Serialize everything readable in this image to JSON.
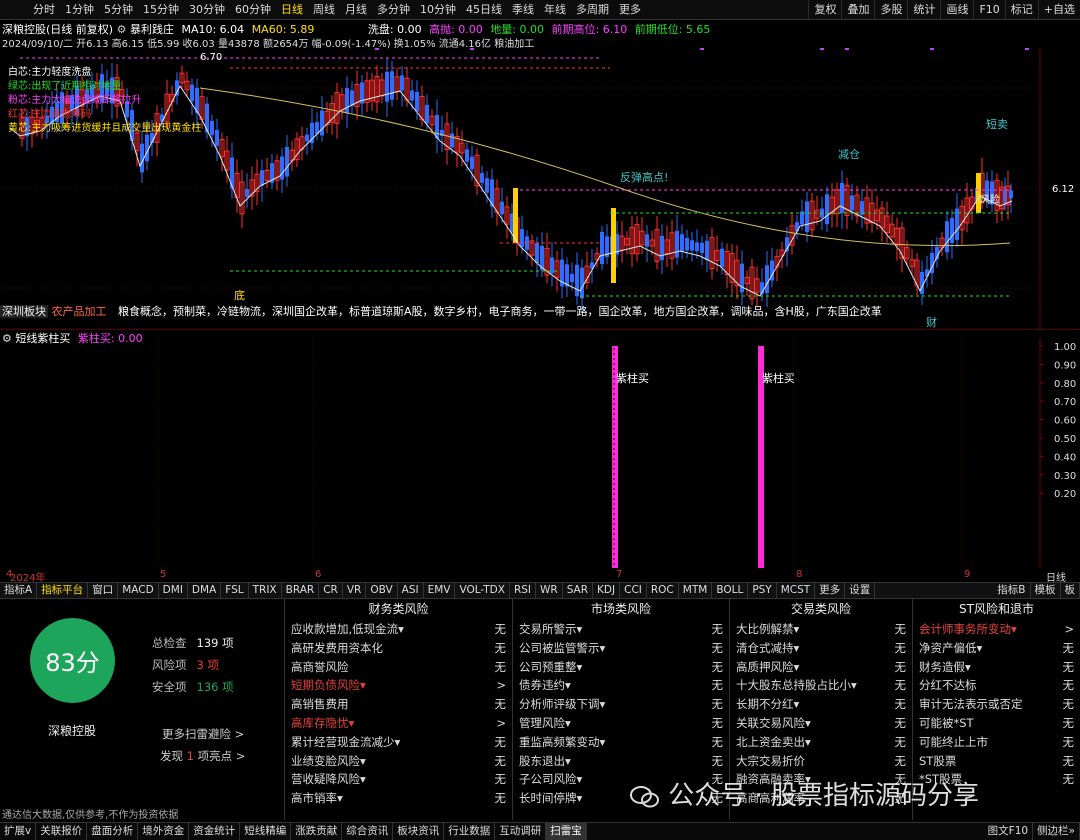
{
  "periods": [
    "分时",
    "1分钟",
    "5分钟",
    "15分钟",
    "30分钟",
    "60分钟",
    "日线",
    "周线",
    "月线",
    "多分钟",
    "10分钟",
    "45日线",
    "季线",
    "年线",
    "多周期",
    "更多"
  ],
  "period_selected": 6,
  "right_buttons": [
    "复权",
    "叠加",
    "多股",
    "统计",
    "画线",
    "F10",
    "标记",
    "+自选"
  ],
  "title": {
    "stock": "深粮控股(日线 前复权)",
    "indicator": "暴利践庄",
    "ma10": "MA10: 6.04",
    "ma60": "MA60: 5.89",
    "wash": "洗盘: 0.00",
    "hi_label": "高抛: 0.00",
    "bottom": "地量: 0.00",
    "prev_high": "前期高位: 6.10",
    "prev_low": "前期低位: 5.65"
  },
  "info": "2024/09/10/二 开6.13 高6.15 低5.99 收6.03 量43878 额2654万 幅-0.09(-1.47%) 换1.05% 流通4.16亿 粮油加工",
  "legend": [
    "白芯:主力轻度洗盘",
    "绿芯:出现了近期相对地量",
    "粉芯:主力大幅洗盘或即将拉升",
    "红芯:主力高抛筹码",
    "黄芯:主力吸筹进货缓并且成交量出现黄金柱"
  ],
  "chart_labels": {
    "top_price": "6.70",
    "rebound": "反弹高点!",
    "reduce": "减仓",
    "short_sell": "短卖",
    "bottom": "底",
    "finance": "财",
    "right_price": "6.12",
    "right_small": "风险"
  },
  "concepts": "粮食概念，预制菜，冷链物流，深圳国企改革，标普道琼斯A股，数字乡村，电子商务，一带一路，国企改革，地方国企改革，调味品，含H股，广东国企改革",
  "concept_prefix": "深圳板块",
  "concept_tag": "农产品加工",
  "sub_title": {
    "name": "短线紫柱买",
    "val": "紫柱买: 0.00"
  },
  "sub_labels": [
    "紫柱买",
    "紫柱买"
  ],
  "sub_axis": [
    "1.00",
    "0.90",
    "0.80",
    "0.70",
    "0.60",
    "0.50",
    "0.40",
    "0.30",
    "0.20"
  ],
  "date_ticks": [
    "2024年",
    "4",
    "5",
    "6",
    "7",
    "8",
    "9"
  ],
  "date_right": "日线",
  "tabs": [
    "指标A",
    "指标平台",
    "窗口",
    "MACD",
    "DMI",
    "DMA",
    "FSL",
    "TRIX",
    "BRAR",
    "CR",
    "VR",
    "OBV",
    "ASI",
    "EMV",
    "VOL-TDX",
    "RSI",
    "WR",
    "SAR",
    "KDJ",
    "CCI",
    "ROC",
    "MTM",
    "BOLL",
    "PSY",
    "MCST",
    "更多",
    "设置"
  ],
  "tabs_right": [
    "指标B",
    "模板",
    "板"
  ],
  "score": {
    "value": "83分",
    "name": "深粮控股",
    "total_label": "总检查",
    "total": "139 项",
    "risk_label": "风险项",
    "risk": "3 项",
    "safe_label": "安全项",
    "safe": "136 项",
    "more": "更多扫雷避险 >",
    "find_pre": "发现",
    "find_num": "1",
    "find_post": "项亮点 >"
  },
  "columns": [
    {
      "title": "财务类风险",
      "rows": [
        [
          "应收款增加,低现金流▾",
          "无"
        ],
        [
          "高研发费用资本化",
          "无"
        ],
        [
          "高商誉风险",
          "无"
        ],
        [
          "短期负债风险▾",
          ">"
        ],
        [
          "高销售费用",
          "无"
        ],
        [
          "高库存隐忧▾",
          ">"
        ],
        [
          "累计经营现金流减少▾",
          "无"
        ],
        [
          "业绩变脸风险▾",
          "无"
        ],
        [
          "营收疑降风险▾",
          "无"
        ],
        [
          "高市销率▾",
          "无"
        ]
      ]
    },
    {
      "title": "市场类风险",
      "rows": [
        [
          "交易所警示▾",
          "无"
        ],
        [
          "公司被监管警示▾",
          "无"
        ],
        [
          "公司预重整▾",
          "无"
        ],
        [
          "债券违约▾",
          "无"
        ],
        [
          "分析师评级下调▾",
          "无"
        ],
        [
          "管理风险▾",
          "无"
        ],
        [
          "重监高频繁变动▾",
          "无"
        ],
        [
          "股东退出▾",
          "无"
        ],
        [
          "子公司风险▾",
          "无"
        ],
        [
          "长时间停牌▾",
          "无"
        ]
      ]
    },
    {
      "title": "交易类风险",
      "rows": [
        [
          "大比例解禁▾",
          "无"
        ],
        [
          "清仓式减持▾",
          "无"
        ],
        [
          "高质押风险▾",
          "无"
        ],
        [
          "十大股东总持股占比小▾",
          "无"
        ],
        [
          "长期不分红▾",
          "无"
        ],
        [
          "关联交易风险▾",
          "无"
        ],
        [
          "北上资金卖出▾",
          "无"
        ],
        [
          "大宗交易折价",
          "无"
        ],
        [
          "融资高融卖率▾",
          "无"
        ],
        [
          "高商高利润率",
          "无"
        ]
      ]
    },
    {
      "title": "ST风险和退市",
      "rows": [
        [
          "会计师事务所变动▾",
          ">"
        ],
        [
          "净资产偏低▾",
          "无"
        ],
        [
          "财务造假▾",
          "无"
        ],
        [
          "分红不达标",
          "无"
        ],
        [
          "审计无法表示或否定",
          "无"
        ],
        [
          "可能被*ST",
          "无"
        ],
        [
          "可能终止上市",
          "无"
        ],
        [
          "ST股票",
          "无"
        ],
        [
          "*ST股票",
          "无"
        ],
        [
          "",
          ""
        ]
      ]
    }
  ],
  "disclaimer": "通达信大数据,仅供参考,不作为投资依据",
  "bottom_tabs": [
    "扩展v",
    "关联报价",
    "盘面分析",
    "境外资金",
    "资金统计",
    "短线精编",
    "涨跌贡献",
    "综合资讯",
    "板块资讯",
    "行业数据",
    "互动调研",
    "扫雷宝"
  ],
  "bottom_right": [
    "图文F10",
    "侧边栏»"
  ],
  "watermark": "公众号 · 股票指标源码分享"
}
